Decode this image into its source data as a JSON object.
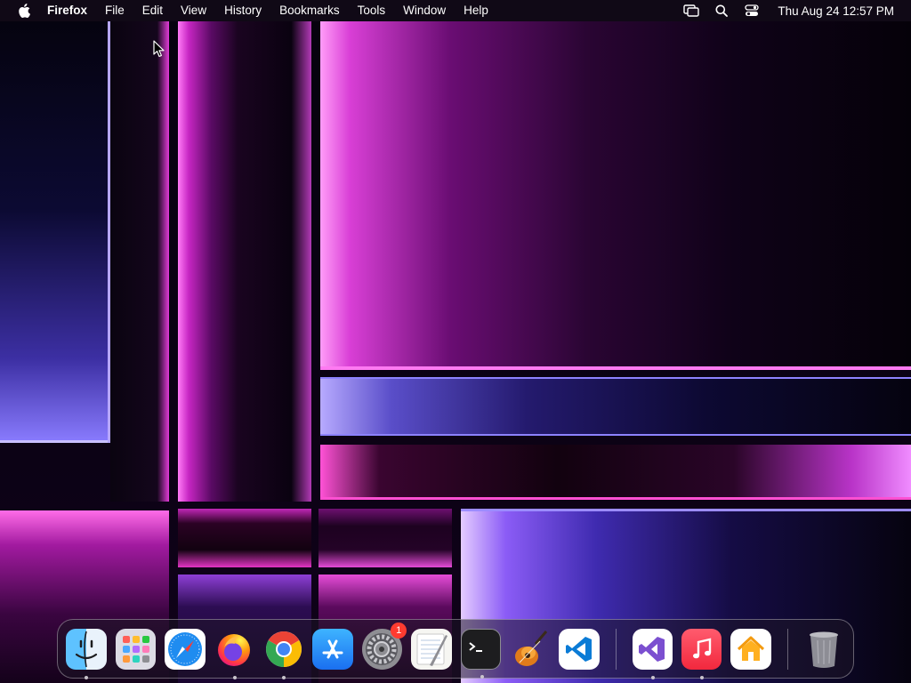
{
  "menubar": {
    "app_name": "Firefox",
    "items": [
      "File",
      "Edit",
      "View",
      "History",
      "Bookmarks",
      "Tools",
      "Window",
      "Help"
    ],
    "status_icons": [
      "screen-mirroring-icon",
      "spotlight-search-icon",
      "control-center-icon"
    ],
    "clock": "Thu Aug 24  12:57 PM"
  },
  "dock": {
    "apps": [
      {
        "name": "Finder",
        "icon": "finder-icon",
        "running": true
      },
      {
        "name": "Launchpad",
        "icon": "launchpad-icon",
        "running": false
      },
      {
        "name": "Safari",
        "icon": "safari-icon",
        "running": false
      },
      {
        "name": "Firefox",
        "icon": "firefox-icon",
        "running": true
      },
      {
        "name": "Google Chrome",
        "icon": "chrome-icon",
        "running": true
      },
      {
        "name": "App Store",
        "icon": "app-store-icon",
        "running": false
      },
      {
        "name": "System Settings",
        "icon": "system-settings-icon",
        "running": false,
        "badge": "1"
      },
      {
        "name": "TextEdit",
        "icon": "textedit-icon",
        "running": false
      },
      {
        "name": "Terminal",
        "icon": "terminal-icon",
        "running": true
      },
      {
        "name": "GarageBand",
        "icon": "garageband-icon",
        "running": false
      },
      {
        "name": "Visual Studio Code",
        "icon": "vscode-icon",
        "running": false
      }
    ],
    "recent_apps": [
      {
        "name": "Visual Studio",
        "icon": "visual-studio-icon",
        "running": true
      },
      {
        "name": "Music",
        "icon": "music-icon",
        "running": true
      },
      {
        "name": "Home",
        "icon": "home-icon",
        "running": false
      }
    ],
    "trash": {
      "name": "Trash",
      "icon": "trash-icon"
    }
  }
}
